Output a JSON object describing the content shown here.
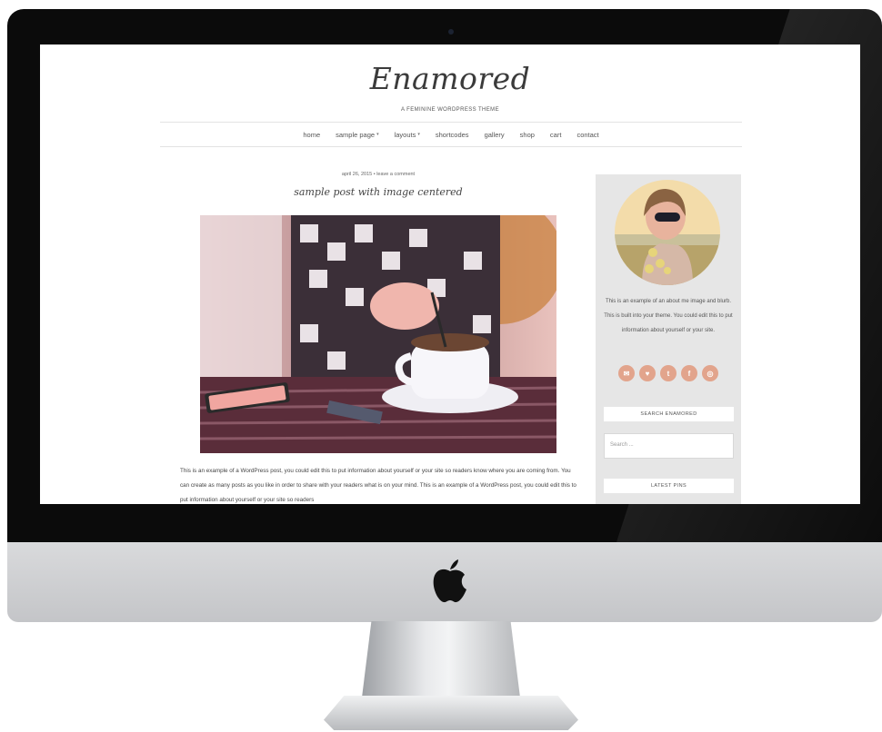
{
  "site": {
    "title": "Enamored",
    "tagline": "A FEMININE WORDPRESS THEME"
  },
  "nav": {
    "items": [
      {
        "label": "home",
        "has_dropdown": false
      },
      {
        "label": "sample page",
        "has_dropdown": true
      },
      {
        "label": "layouts",
        "has_dropdown": true
      },
      {
        "label": "shortcodes",
        "has_dropdown": false
      },
      {
        "label": "gallery",
        "has_dropdown": false
      },
      {
        "label": "shop",
        "has_dropdown": false
      },
      {
        "label": "cart",
        "has_dropdown": false
      },
      {
        "label": "contact",
        "has_dropdown": false
      }
    ],
    "caret": "▾"
  },
  "post": {
    "meta": "april 26, 2015 • leave a comment",
    "title": "sample post with image centered",
    "body": "This is an example of a WordPress post, you could edit this to put information about yourself or your site so readers know where you are coming from. You can create as many posts as you like in order to share with your readers what is on your mind. This is an example of a WordPress post, you could edit this to put information about yourself or your site so readers"
  },
  "sidebar": {
    "about_text": "This is an example of an about me image and blurb. This is built into your theme. You could edit this to put information about yourself or your site.",
    "social": [
      {
        "icon": "email-icon",
        "glyph": "✉"
      },
      {
        "icon": "heart-icon",
        "glyph": "♥"
      },
      {
        "icon": "twitter-icon",
        "glyph": "t"
      },
      {
        "icon": "facebook-icon",
        "glyph": "f"
      },
      {
        "icon": "instagram-icon",
        "glyph": "◎"
      }
    ],
    "search_title": "SEARCH ENAMORED",
    "search_placeholder": "Search ...",
    "latest_pins_title": "LATEST PINS"
  },
  "colors": {
    "accent": "#e2a48c",
    "sidebar_bg": "#e6e6e6",
    "bezel": "#0b0b0b"
  }
}
